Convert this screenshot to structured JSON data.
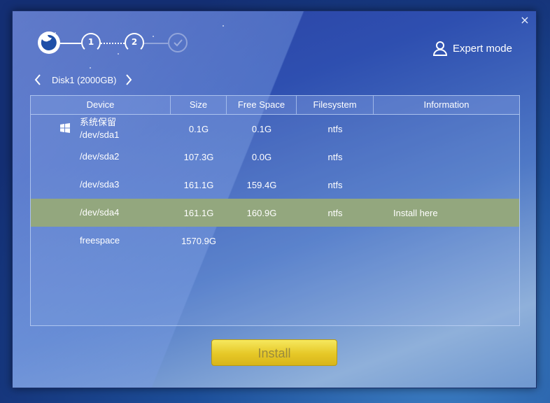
{
  "window": {
    "close_label": "×"
  },
  "stepper": {
    "steps": [
      {
        "label": "1",
        "state": "done"
      },
      {
        "label": "2",
        "state": "current"
      },
      {
        "label": "",
        "state": "pending"
      }
    ]
  },
  "header": {
    "expert_mode_label": "Expert mode"
  },
  "disk_nav": {
    "label": "Disk1 (2000GB)"
  },
  "table": {
    "columns": [
      "Device",
      "Size",
      "Free Space",
      "Filesystem",
      "Information"
    ],
    "rows": [
      {
        "device_sub": "系统保留",
        "device": "/dev/sda1",
        "size": "0.1G",
        "free": "0.1G",
        "fs": "ntfs",
        "info": "",
        "icon": "windows-icon",
        "selected": false
      },
      {
        "device_sub": "",
        "device": "/dev/sda2",
        "size": "107.3G",
        "free": "0.0G",
        "fs": "ntfs",
        "info": "",
        "icon": "",
        "selected": false
      },
      {
        "device_sub": "",
        "device": "/dev/sda3",
        "size": "161.1G",
        "free": "159.4G",
        "fs": "ntfs",
        "info": "",
        "icon": "",
        "selected": false
      },
      {
        "device_sub": "",
        "device": "/dev/sda4",
        "size": "161.1G",
        "free": "160.9G",
        "fs": "ntfs",
        "info": "Install here",
        "icon": "",
        "selected": true
      },
      {
        "device_sub": "",
        "device": "freespace",
        "size": "1570.9G",
        "free": "",
        "fs": "",
        "info": "",
        "icon": "",
        "selected": false
      }
    ]
  },
  "install_button": {
    "label": "Install"
  },
  "colors": {
    "selected_row": "#93a77e",
    "install_button": "#e6c827",
    "accent": "#ffffff"
  }
}
